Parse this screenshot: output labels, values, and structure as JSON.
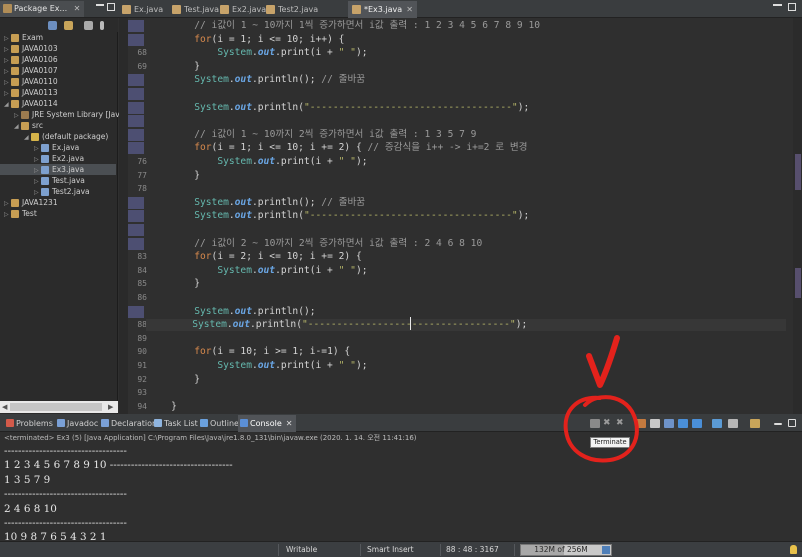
{
  "package_explorer": {
    "tab_label": "Package Ex...",
    "tree": [
      {
        "label": "Exam",
        "depth": 0,
        "twisty": "▷",
        "icon": "project-icon"
      },
      {
        "label": "JAVA0103",
        "depth": 0,
        "twisty": "▷",
        "icon": "project-icon"
      },
      {
        "label": "JAVA0106",
        "depth": 0,
        "twisty": "▷",
        "icon": "project-icon"
      },
      {
        "label": "JAVA0107",
        "depth": 0,
        "twisty": "▷",
        "icon": "project-icon"
      },
      {
        "label": "JAVA0110",
        "depth": 0,
        "twisty": "▷",
        "icon": "project-icon"
      },
      {
        "label": "JAVA0113",
        "depth": 0,
        "twisty": "▷",
        "icon": "project-icon"
      },
      {
        "label": "JAVA0114",
        "depth": 0,
        "twisty": "◢",
        "icon": "project-icon"
      },
      {
        "label": "JRE System Library [Java",
        "depth": 1,
        "twisty": "▷",
        "icon": "library-icon"
      },
      {
        "label": "src",
        "depth": 1,
        "twisty": "◢",
        "icon": "source-folder-icon"
      },
      {
        "label": "(default package)",
        "depth": 2,
        "twisty": "◢",
        "icon": "package-icon"
      },
      {
        "label": "Ex.java",
        "depth": 3,
        "twisty": "▷",
        "icon": "java-file-icon"
      },
      {
        "label": "Ex2.java",
        "depth": 3,
        "twisty": "▷",
        "icon": "java-file-icon"
      },
      {
        "label": "Ex3.java",
        "depth": 3,
        "twisty": "▷",
        "icon": "java-file-icon",
        "selected": true
      },
      {
        "label": "Test.java",
        "depth": 3,
        "twisty": "▷",
        "icon": "java-file-icon"
      },
      {
        "label": "Test2.java",
        "depth": 3,
        "twisty": "▷",
        "icon": "java-file-icon"
      },
      {
        "label": "JAVA1231",
        "depth": 0,
        "twisty": "▷",
        "icon": "project-icon"
      },
      {
        "label": "Test",
        "depth": 0,
        "twisty": "▷",
        "icon": "project-icon"
      }
    ]
  },
  "editor": {
    "tabs": [
      {
        "label": "Ex.java",
        "active": false
      },
      {
        "label": "Test.java",
        "active": false
      },
      {
        "label": "Ex2.java",
        "active": false
      },
      {
        "label": "Test2.java",
        "active": false
      },
      {
        "label": "*Ex3.java",
        "active": true
      }
    ],
    "lines": [
      {
        "n": "",
        "changed": true,
        "html": "        <span class=\"cm\">// i값이 1 ~ 10까지 1씩 증가하면서 i값 출력 : 1 2 3 4 5 6 7 8 9 10</span>"
      },
      {
        "n": "",
        "changed": true,
        "html": "        <span class=\"kw\">for</span>(i = 1; i &lt;= 10; i++) {"
      },
      {
        "n": "68",
        "changed": false,
        "html": "            <span class=\"cls\">System</span>.<span class=\"fld\">out</span>.print(i + <span class=\"str\">\" \"</span>);"
      },
      {
        "n": "69",
        "changed": false,
        "html": "        }"
      },
      {
        "n": "",
        "changed": true,
        "html": "        <span class=\"cls\">System</span>.<span class=\"fld\">out</span>.println(); <span class=\"cm\">// 줄바꿈</span>"
      },
      {
        "n": "",
        "changed": true,
        "html": ""
      },
      {
        "n": "",
        "changed": true,
        "html": "        <span class=\"cls\">System</span>.<span class=\"fld\">out</span>.println(<span class=\"str\">\"-----------------------------------\"</span>);"
      },
      {
        "n": "",
        "changed": true,
        "html": ""
      },
      {
        "n": "",
        "changed": true,
        "html": "        <span class=\"cm\">// i값이 1 ~ 10까지 2씩 증가하면서 i값 출력 : 1 3 5 7 9</span>"
      },
      {
        "n": "",
        "changed": true,
        "html": "        <span class=\"kw\">for</span>(i = 1; i &lt;= 10; i += 2) { <span class=\"cm\">// 증감식을 i++ -&gt; i+=2 로 변경</span>"
      },
      {
        "n": "76",
        "changed": false,
        "html": "            <span class=\"cls\">System</span>.<span class=\"fld\">out</span>.print(i + <span class=\"str\">\" \"</span>);"
      },
      {
        "n": "77",
        "changed": false,
        "html": "        }"
      },
      {
        "n": "78",
        "changed": false,
        "html": ""
      },
      {
        "n": "",
        "changed": true,
        "html": "        <span class=\"cls\">System</span>.<span class=\"fld\">out</span>.println(); <span class=\"cm\">// 줄바꿈</span>"
      },
      {
        "n": "",
        "changed": true,
        "html": "        <span class=\"cls\">System</span>.<span class=\"fld\">out</span>.println(<span class=\"str\">\"-----------------------------------\"</span>);"
      },
      {
        "n": "",
        "changed": true,
        "html": ""
      },
      {
        "n": "",
        "changed": true,
        "html": "        <span class=\"cm\">// i값이 2 ~ 10까지 2씩 증가하면서 i값 출력 : 2 4 6 8 10</span>"
      },
      {
        "n": "83",
        "changed": false,
        "html": "        <span class=\"kw\">for</span>(i = 2; i &lt;= 10; i += 2) {"
      },
      {
        "n": "84",
        "changed": false,
        "html": "            <span class=\"cls\">System</span>.<span class=\"fld\">out</span>.print(i + <span class=\"str\">\" \"</span>);"
      },
      {
        "n": "85",
        "changed": false,
        "html": "        }"
      },
      {
        "n": "86",
        "changed": false,
        "html": ""
      },
      {
        "n": "",
        "changed": true,
        "html": "        <span class=\"cls\">System</span>.<span class=\"fld\">out</span>.println();"
      },
      {
        "n": "88",
        "changed": false,
        "current": true,
        "html": "        <span class=\"cls\">System</span>.<span class=\"fld\">out</span>.println(<span class=\"str\">\"-----------------------------------\"</span>);"
      },
      {
        "n": "89",
        "changed": false,
        "html": ""
      },
      {
        "n": "90",
        "changed": false,
        "html": "        <span class=\"kw\">for</span>(i = 10; i &gt;= 1; i-=1) {"
      },
      {
        "n": "91",
        "changed": false,
        "html": "            <span class=\"cls\">System</span>.<span class=\"fld\">out</span>.print(i + <span class=\"str\">\" \"</span>);"
      },
      {
        "n": "92",
        "changed": false,
        "html": "        }"
      },
      {
        "n": "93",
        "changed": false,
        "html": ""
      },
      {
        "n": "94",
        "changed": false,
        "html": "    }"
      }
    ]
  },
  "console_panel": {
    "tabs": [
      {
        "label": "Problems",
        "icon": "problems-icon",
        "color": "#d25a4a",
        "active": false
      },
      {
        "label": "Javadoc",
        "icon": "javadoc-icon",
        "color": "#7aa0d6",
        "active": false
      },
      {
        "label": "Declaration",
        "icon": "declaration-icon",
        "color": "#7aa0d6",
        "active": false
      },
      {
        "label": "Task List",
        "icon": "task-list-icon",
        "color": "#8fb5e0",
        "active": false
      },
      {
        "label": "Outline",
        "icon": "outline-icon",
        "color": "#6aa0dc",
        "active": false
      },
      {
        "label": "Console",
        "icon": "console-icon",
        "color": "#5b8fd6",
        "active": true
      }
    ],
    "info": "<terminated> Ex3 (5) [Java Application] C:\\Program Files\\Java\\jre1.8.0_131\\bin\\javaw.exe (2020. 1. 14. 오전 11:41:16)",
    "output": [
      "-----------------------------------",
      "1 2 3 4 5 6 7 8 9 10 -----------------------------------",
      "1 3 5 7 9",
      "-----------------------------------",
      "2 4 6 8 10",
      "-----------------------------------",
      "10 9 8 7 6 5 4 3 2 1"
    ],
    "terminate_tooltip": "Terminate"
  },
  "status_bar": {
    "writable": "Writable",
    "insert_mode": "Smart Insert",
    "position": "88 : 48 : 3167",
    "heap": "132M of 256M",
    "heap_fraction": 0.52
  }
}
